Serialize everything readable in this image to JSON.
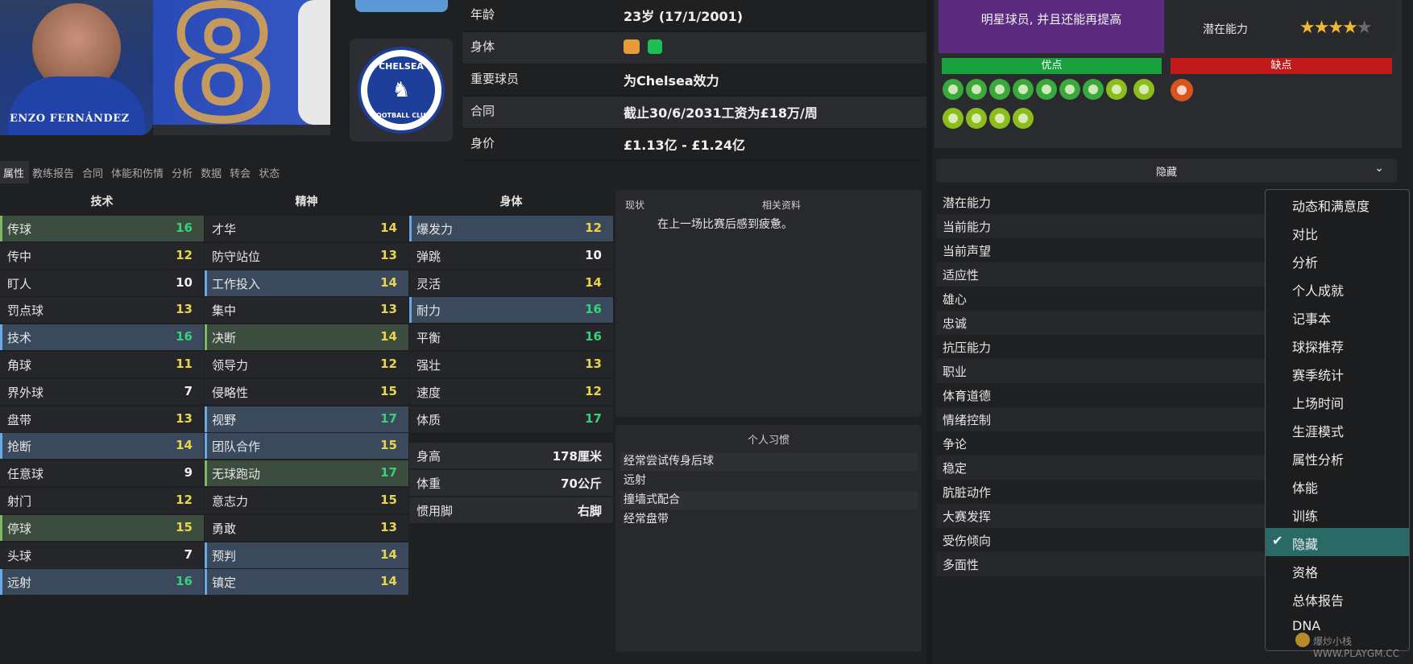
{
  "player": {
    "name_plate": "ENZO FERNÁNDEZ",
    "shirt_number": "8"
  },
  "club": {
    "crest_top": "CHELSEA",
    "crest_bottom": "FOOTBALL CLUB"
  },
  "info": [
    {
      "key": "年龄",
      "value": "23岁 (17/1/2001)"
    },
    {
      "key": "身体",
      "value": ""
    },
    {
      "key": "重要球员",
      "value": "为Chelsea效力"
    },
    {
      "key": "合同",
      "value": "截止30/6/2031工资为£18万/周"
    },
    {
      "key": "身价",
      "value": "£1.13亿 - £1.24亿"
    }
  ],
  "scout": {
    "summary": "明星球员, 并且还能再提高",
    "potential_label": "潜在能力",
    "stars_full": "★★★★",
    "stars_empty": "★"
  },
  "pros_label": "优点",
  "cons_label": "缺点",
  "tabs": [
    "属性",
    "教练报告",
    "合同",
    "体能和伤情",
    "分析",
    "数据",
    "转会",
    "状态"
  ],
  "columns": {
    "technical": "技术",
    "mental": "精神",
    "physical": "身体"
  },
  "technical": [
    {
      "name": "传球",
      "value": "16"
    },
    {
      "name": "传中",
      "value": "12"
    },
    {
      "name": "盯人",
      "value": "10"
    },
    {
      "name": "罚点球",
      "value": "13"
    },
    {
      "name": "技术",
      "value": "16"
    },
    {
      "name": "角球",
      "value": "11"
    },
    {
      "name": "界外球",
      "value": "7"
    },
    {
      "name": "盘带",
      "value": "13"
    },
    {
      "name": "抢断",
      "value": "14"
    },
    {
      "name": "任意球",
      "value": "9"
    },
    {
      "name": "射门",
      "value": "12"
    },
    {
      "name": "停球",
      "value": "15"
    },
    {
      "name": "头球",
      "value": "7"
    },
    {
      "name": "远射",
      "value": "16"
    }
  ],
  "mental": [
    {
      "name": "才华",
      "value": "14"
    },
    {
      "name": "防守站位",
      "value": "13"
    },
    {
      "name": "工作投入",
      "value": "14"
    },
    {
      "name": "集中",
      "value": "13"
    },
    {
      "name": "决断",
      "value": "14"
    },
    {
      "name": "领导力",
      "value": "12"
    },
    {
      "name": "侵略性",
      "value": "15"
    },
    {
      "name": "视野",
      "value": "17"
    },
    {
      "name": "团队合作",
      "value": "15"
    },
    {
      "name": "无球跑动",
      "value": "17"
    },
    {
      "name": "意志力",
      "value": "15"
    },
    {
      "name": "勇敢",
      "value": "13"
    },
    {
      "name": "预判",
      "value": "14"
    },
    {
      "name": "镇定",
      "value": "14"
    }
  ],
  "physical": [
    {
      "name": "爆发力",
      "value": "12"
    },
    {
      "name": "弹跳",
      "value": "10"
    },
    {
      "name": "灵活",
      "value": "14"
    },
    {
      "name": "耐力",
      "value": "16"
    },
    {
      "name": "平衡",
      "value": "16"
    },
    {
      "name": "强壮",
      "value": "13"
    },
    {
      "name": "速度",
      "value": "12"
    },
    {
      "name": "体质",
      "value": "17"
    }
  ],
  "physical_info": [
    {
      "name": "身高",
      "value": "178厘米"
    },
    {
      "name": "体重",
      "value": "70公斤"
    },
    {
      "name": "惯用脚",
      "value": "右脚"
    }
  ],
  "status_panel": {
    "heading_status": "现状",
    "heading_related": "相关资料",
    "text": "在上一场比赛后感到疲惫。"
  },
  "habits_panel": {
    "heading": "个人习惯",
    "items": [
      "经常尝试传身后球",
      "远射",
      "撞墙式配合",
      "经常盘带"
    ]
  },
  "hidden_bar": {
    "label": "隐藏"
  },
  "hidden_attributes": [
    "潜在能力",
    "当前能力",
    "当前声望",
    "适应性",
    "雄心",
    "忠诚",
    "抗压能力",
    "职业",
    "体育道德",
    "情绪控制",
    "争论",
    "稳定",
    "肮脏动作",
    "大赛发挥",
    "受伤倾向",
    "多面性"
  ],
  "menu": {
    "items": [
      "动态和满意度",
      "对比",
      "分析",
      "个人成就",
      "记事本",
      "球探推荐",
      "赛季统计",
      "上场时间",
      "生涯模式",
      "属性分析",
      "体能",
      "训练",
      "隐藏",
      "资格",
      "总体报告",
      "DNA"
    ],
    "selected": "隐藏"
  },
  "watermark": "爆炒小栈 WWW.PLAYGM.CC",
  "colors": {
    "accent_blue": "#6aa7e8",
    "pros_green": "#19a13f",
    "cons_red": "#c21a1a",
    "menu_selected": "#2a6a66"
  }
}
